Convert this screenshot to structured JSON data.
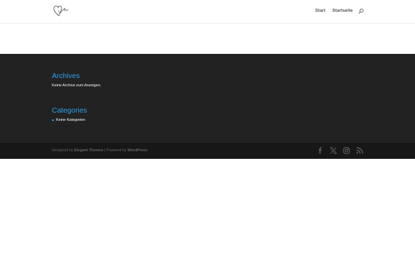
{
  "header": {
    "logo_icon": "heart-signature-logo",
    "nav": {
      "start_label": "Start",
      "startseite_label": "Startseite",
      "search_icon": "search-icon"
    }
  },
  "footer": {
    "archives": {
      "title": "Archives",
      "text": "Keine Archive zum Anzeigen."
    },
    "categories": {
      "title": "Categories",
      "items": [
        "Keine Kategorien"
      ]
    }
  },
  "bottom_bar": {
    "designed_by_prefix": "Designed by ",
    "designed_by_link": "Elegant Themes",
    "separator": " | Powered by ",
    "powered_by_link": "WordPress",
    "social_icons": [
      "facebook-icon",
      "x-icon",
      "instagram-icon",
      "rss-icon"
    ]
  },
  "colors": {
    "accent": "#2ea3f2",
    "footer_bg": "#222222",
    "bottom_bar_bg": "#171717",
    "nav_text": "#555555"
  }
}
